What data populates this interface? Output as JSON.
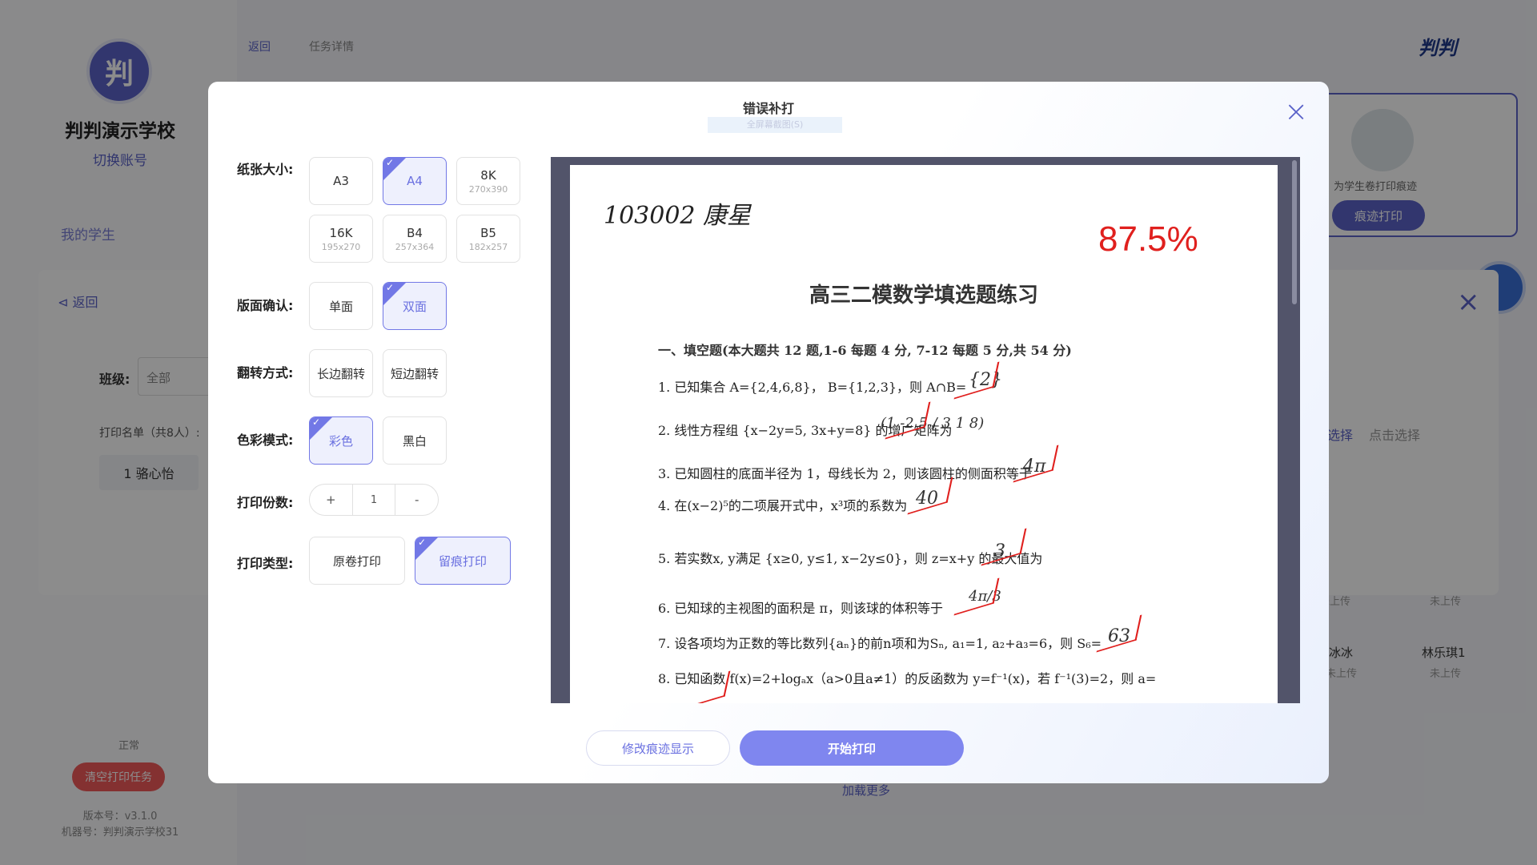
{
  "background": {
    "sidebar": {
      "avatar_char": "判",
      "school_name": "判判演示学校",
      "switch_account": "切换账号",
      "my_students": "我的学生",
      "status": "正常",
      "clear_tasks": "清空打印任务",
      "version": "版本号：v3.1.0",
      "machine": "机器号：判判演示学校31"
    },
    "topnav": {
      "back": "返回",
      "task_detail": "任务详情"
    },
    "brand": "判判",
    "print_card": {
      "text": "为学生卷打印痕迹",
      "button": "痕迹打印"
    },
    "panel": {
      "back": "返回",
      "class_label": "班级:",
      "class_value": "全部",
      "print_list": "打印名单（共8人）:",
      "first_student": "1 骆心怡",
      "select_all": "选择",
      "click_select": "点击选择",
      "load_more": "加载更多"
    },
    "grid": [
      {
        "name": "",
        "status": "未上传"
      },
      {
        "name": "",
        "status": "未上传"
      },
      {
        "name": "冰冰",
        "status": "未上传"
      },
      {
        "name": "林乐琪1",
        "status": "未上传"
      }
    ]
  },
  "modal": {
    "title": "错误补打",
    "subtitle": "全屏幕截图(S)",
    "paper_size": {
      "label": "纸张大小:",
      "options": [
        {
          "name": "A3",
          "size": ""
        },
        {
          "name": "A4",
          "size": ""
        },
        {
          "name": "8K",
          "size": "270x390"
        },
        {
          "name": "16K",
          "size": "195x270"
        },
        {
          "name": "B4",
          "size": "257x364"
        },
        {
          "name": "B5",
          "size": "182x257"
        }
      ],
      "selected": "A4"
    },
    "layout": {
      "label": "版面确认:",
      "options": [
        "单面",
        "双面"
      ],
      "selected": "双面"
    },
    "flip": {
      "label": "翻转方式:",
      "options": [
        "长边翻转",
        "短边翻转"
      ]
    },
    "color": {
      "label": "色彩模式:",
      "options": [
        "彩色",
        "黑白"
      ],
      "selected": "彩色"
    },
    "copies": {
      "label": "打印份数:",
      "plus": "+",
      "value": "1",
      "minus": "-"
    },
    "type": {
      "label": "打印类型:",
      "options": [
        "原卷打印",
        "留痕打印"
      ],
      "selected": "留痕打印"
    },
    "buttons": {
      "modify": "修改痕迹显示",
      "start": "开始打印"
    }
  },
  "document": {
    "handwritten_name": "103002 康星",
    "score": "87.5%",
    "title": "高三二模数学填选题练习",
    "section": "一、填空题(本大题共 12 题,1-6 每题 4 分, 7-12 每题 5 分,共 54 分)",
    "questions": [
      "1. 已知集合 A={2,4,6,8}，  B={1,2,3}，则 A∩B=",
      "2. 线性方程组 {x−2y=5, 3x+y=8} 的增广矩阵为",
      "3. 已知圆柱的底面半径为 1，母线长为 2，则该圆柱的侧面积等于",
      "4. 在(x−2)⁵的二项展开式中，x³项的系数为",
      "5. 若实数x, y满足 {x≥0, y≤1, x−2y≤0}，则 z=x+y 的最大值为",
      "6. 已知球的主视图的面积是 π，则该球的体积等于",
      "7. 设各项均为正数的等比数列{aₙ}的前n项和为Sₙ, a₁=1, a₂+a₃=6，则 S₆=",
      "8. 已知函数 f(x)=2+logₐx（a>0且a≠1）的反函数为 y=f⁻¹(x)，若 f⁻¹(3)=2，则 a="
    ],
    "answers": [
      "{2}",
      "(1 -2 5 / 3 1 8)",
      "4π",
      "40",
      "3",
      "4π/3",
      "63"
    ]
  }
}
